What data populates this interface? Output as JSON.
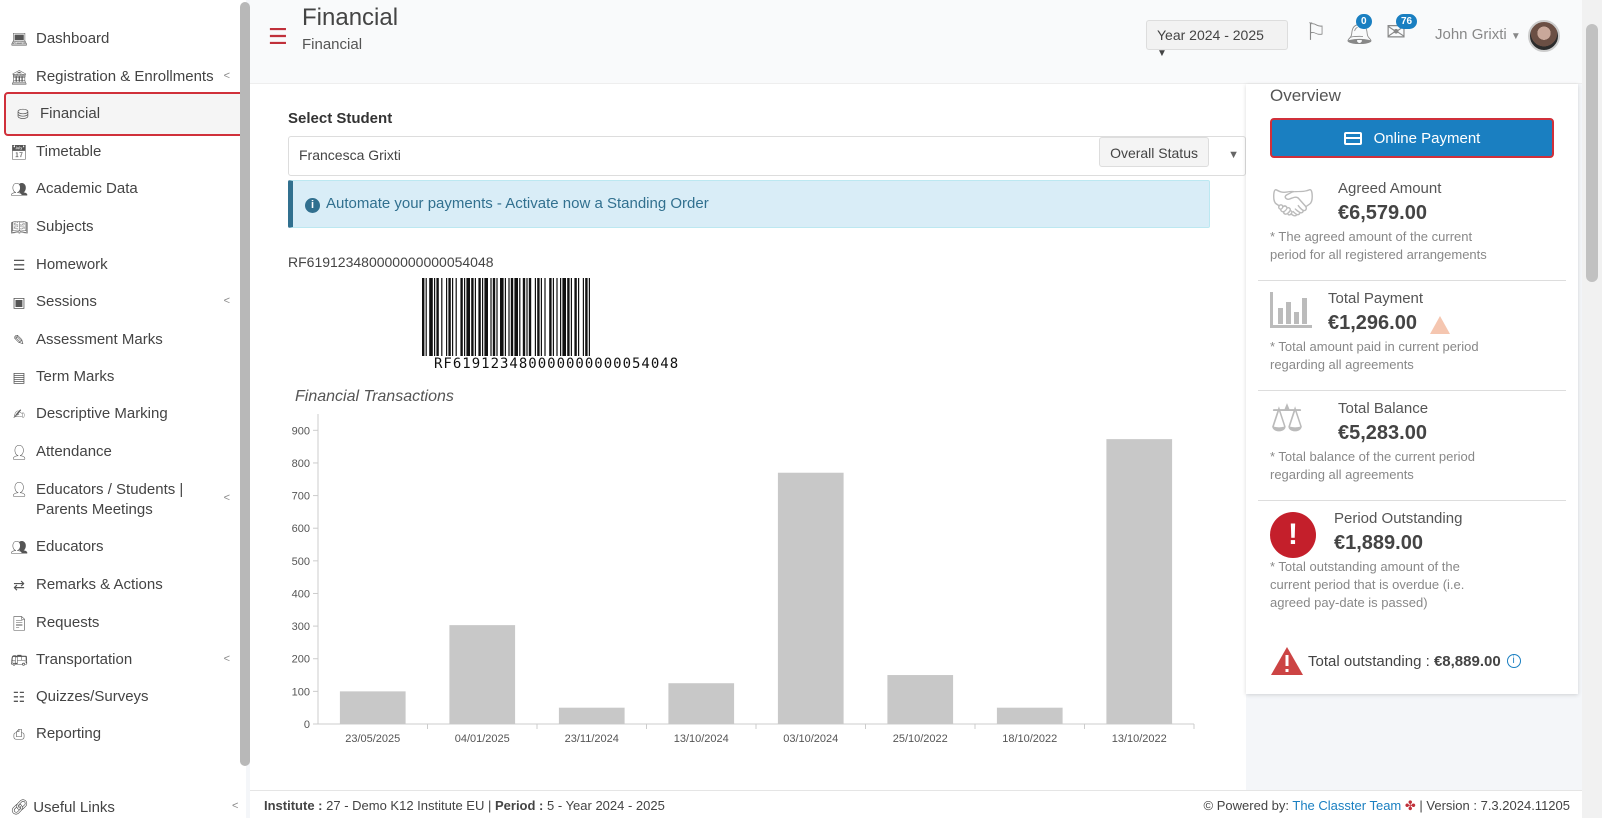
{
  "sidebar": {
    "items": [
      {
        "label": "Dashboard",
        "icon": "laptop-icon"
      },
      {
        "label": "Registration & Enrollments",
        "icon": "institution-icon",
        "caret": true
      },
      {
        "label": "Financial",
        "icon": "coins-icon",
        "active": true
      },
      {
        "label": "Timetable",
        "icon": "calendar-icon"
      },
      {
        "label": "Academic Data",
        "icon": "users-chart-icon"
      },
      {
        "label": "Subjects",
        "icon": "book-icon"
      },
      {
        "label": "Homework",
        "icon": "list-check-icon"
      },
      {
        "label": "Sessions",
        "icon": "chalkboard-icon",
        "caret": true
      },
      {
        "label": "Assessment Marks",
        "icon": "edit-icon"
      },
      {
        "label": "Term Marks",
        "icon": "notebook-icon"
      },
      {
        "label": "Descriptive Marking",
        "icon": "pen-square-icon"
      },
      {
        "label": "Attendance",
        "icon": "user-x-icon"
      },
      {
        "label": "Educators / Students | Parents Meetings",
        "icon": "user-clock-icon",
        "caret": true
      },
      {
        "label": "Educators",
        "icon": "users-icon"
      },
      {
        "label": "Remarks & Actions",
        "icon": "shuffle-icon"
      },
      {
        "label": "Requests",
        "icon": "file-request-icon"
      },
      {
        "label": "Transportation",
        "icon": "bus-icon",
        "caret": true
      },
      {
        "label": "Quizzes/Surveys",
        "icon": "list-icon"
      },
      {
        "label": "Reporting",
        "icon": "printer-icon"
      }
    ],
    "useful_links": "Useful Links"
  },
  "header": {
    "title": "Financial",
    "subtitle": "Financial",
    "year": "Year 2024 - 2025",
    "notifications_count": "0",
    "messages_count": "76",
    "user_name": "John Grixti"
  },
  "student": {
    "label": "Select Student",
    "value": "Francesca Grixti",
    "status_button": "Overall Status"
  },
  "alert": {
    "text": "Automate your payments - Activate now a Standing Order"
  },
  "reference": {
    "code": "RF619123480000000000054048",
    "barcode_text": "RF619123480000000000054048"
  },
  "chart_title": "Financial Transactions",
  "chart_data": {
    "type": "bar",
    "categories": [
      "23/05/2025",
      "04/01/2025",
      "23/11/2024",
      "13/10/2024",
      "03/10/2024",
      "25/10/2022",
      "18/10/2022",
      "13/10/2022"
    ],
    "values": [
      100,
      303,
      50,
      125,
      770,
      150,
      50,
      873
    ],
    "ylim": [
      0,
      900
    ],
    "yticks": [
      0,
      100,
      200,
      300,
      400,
      500,
      600,
      700,
      800,
      900
    ],
    "color": "#c8c8c8",
    "grid": false
  },
  "overview": {
    "title": "Overview",
    "pay_button": "Online Payment",
    "agreed_label": "Agreed Amount",
    "agreed_amount": "€6,579.00",
    "agreed_note": "* The agreed amount of the current period for all registered arrangements",
    "payment_label": "Total Payment",
    "payment_amount": "€1,296.00",
    "payment_note": "* Total amount paid in current period regarding all agreements",
    "balance_label": "Total Balance",
    "balance_amount": "€5,283.00",
    "balance_note": "* Total balance of the current period regarding all agreements",
    "outstanding_label": "Period Outstanding",
    "outstanding_amount": "€1,889.00",
    "outstanding_note": "* Total outstanding amount of the current period that is overdue (i.e. agreed pay-date is passed)",
    "total_outstanding_label": "Total outstanding :",
    "total_outstanding_value": "€8,889.00"
  },
  "footer": {
    "institute_label": "Institute :",
    "institute_value": "27 - Demo K12 Institute EU",
    "period_label": "Period :",
    "period_value": "5 - Year 2024 - 2025",
    "powered_label": "Powered by:",
    "powered_link": "The Classter Team",
    "version": "| Version : 7.3.2024.11205"
  },
  "colors": {
    "accent": "#c0303a",
    "primary": "#1a7fc1",
    "alert_bg": "#d9edf7",
    "bar": "#c8c8c8"
  }
}
